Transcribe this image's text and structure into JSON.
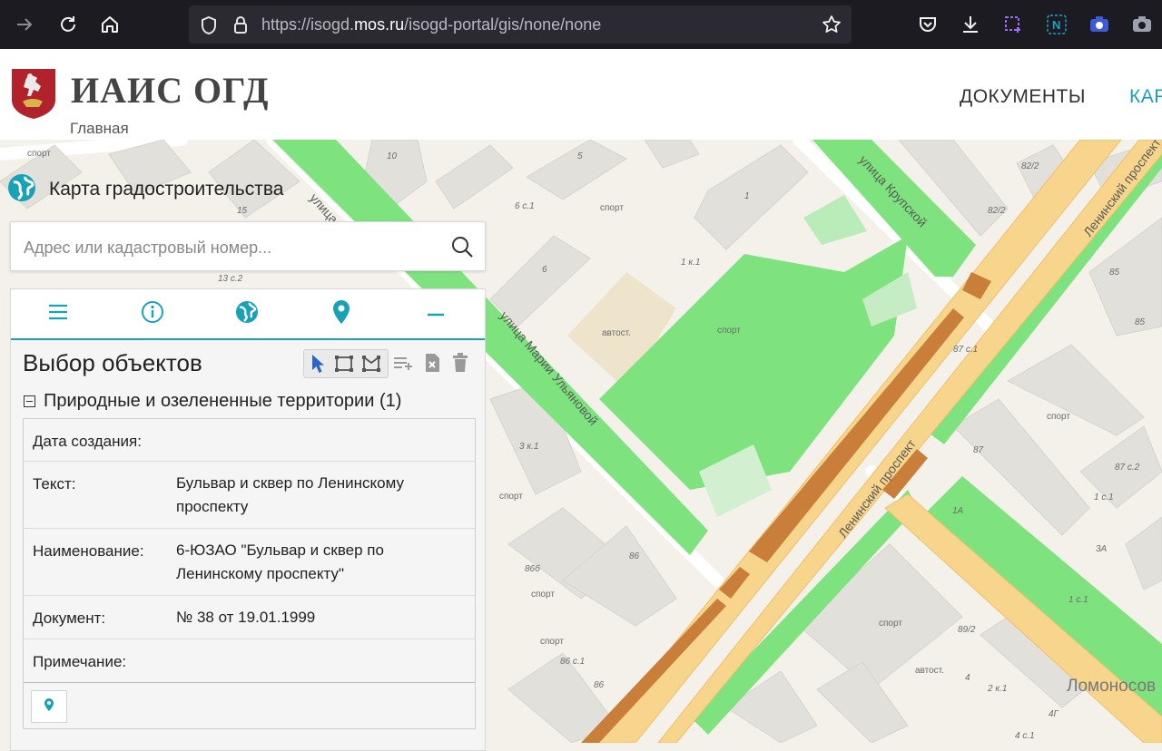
{
  "browser": {
    "url_prefix": "https://isogd.",
    "url_domain": "mos.ru",
    "url_suffix": "/isogd-portal/gis/none/none"
  },
  "header": {
    "brand": "ИАИС ОГД",
    "home_link": "Главная",
    "nav": [
      "ДОКУМЕНТЫ",
      "КАР"
    ]
  },
  "map": {
    "title": "Карта градостроительства",
    "streets": [
      "улица Крупской",
      "Ленинский проспект",
      "улица Марии Ульяновой",
      "Ленинский проспект",
      "улица"
    ],
    "place_labels": [
      "спорт",
      "спорт",
      "спорт",
      "спорт",
      "спорт",
      "спорт",
      "спорт",
      "спорт",
      "автост.",
      "автост.",
      "Ломоносов"
    ],
    "house_numbers": [
      "10",
      "5",
      "6 с.1",
      "1",
      "1 к.1",
      "6",
      "13 с.2",
      "15",
      "3 к.1",
      "86",
      "86б",
      "86 с.1",
      "86",
      "82/2",
      "82/2",
      "85",
      "85",
      "87 с.1",
      "87",
      "87 с.2",
      "1 с.1",
      "1А",
      "3А",
      "89/2",
      "4",
      "2 к.1",
      "4Г",
      "4 с.1",
      "1 с.1"
    ]
  },
  "search": {
    "placeholder": "Адрес или кадастровый номер..."
  },
  "panel": {
    "section_title": "Выбор объектов",
    "group_title": "Природные и озелененные территории (1)",
    "attributes": [
      {
        "key": "Дата создания:",
        "value": ""
      },
      {
        "key": "Текст:",
        "value": "Бульвар и сквер по Ленинскому проспекту"
      },
      {
        "key": "Наименование:",
        "value": "6-ЮЗАО \"Бульвар и сквер по Ленинскому проспекту\""
      },
      {
        "key": "Документ:",
        "value": "№ 38 от 19.01.1999"
      },
      {
        "key": "Примечание:",
        "value": ""
      }
    ]
  },
  "colors": {
    "accent": "#17a2b8",
    "park_green": "#7ee37e",
    "road_yellow": "#f7d58c",
    "road_brown": "#c97f3a",
    "browser_dark": "#1c1b22"
  }
}
